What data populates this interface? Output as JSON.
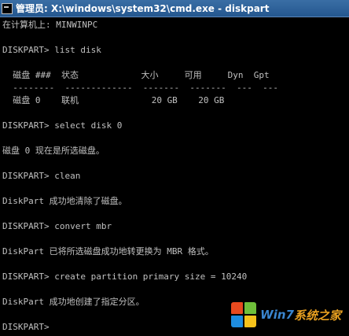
{
  "window": {
    "title": "管理员: X:\\windows\\system32\\cmd.exe - diskpart"
  },
  "console": {
    "lines": [
      "在计算机上: MINWINPC",
      "",
      "DISKPART> list disk",
      "",
      "  磁盘 ###  状态            大小     可用     Dyn  Gpt",
      "  --------  -------------  -------  -------  ---  ---",
      "  磁盘 0    联机              20 GB    20 GB",
      "",
      "DISKPART> select disk 0",
      "",
      "磁盘 0 现在是所选磁盘。",
      "",
      "DISKPART> clean",
      "",
      "DiskPart 成功地清除了磁盘。",
      "",
      "DISKPART> convert mbr",
      "",
      "DiskPart 已将所选磁盘成功地转更换为 MBR 格式。",
      "",
      "DISKPART> create partition primary size = 10240",
      "",
      "DiskPart 成功地创建了指定分区。",
      "",
      "DISKPART> "
    ]
  },
  "watermark": {
    "brand": "Win7",
    "suffix": "系统之家"
  },
  "colors": {
    "title_bg": "#2b5f97",
    "console_text": "#c0c0c0",
    "console_bg": "#000000",
    "brand": "#3a86d0",
    "suffix": "#e8a020"
  }
}
